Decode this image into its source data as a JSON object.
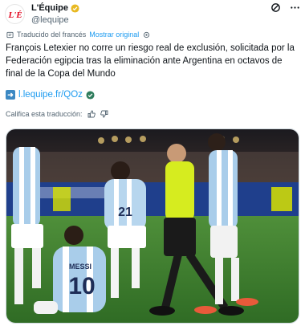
{
  "account": {
    "display_name": "L'Équipe",
    "handle": "@lequipe",
    "logo_text": "L'É",
    "brand_color": "#e2001a",
    "verified_color": "#e8b923"
  },
  "translation": {
    "label": "Traducido del francés",
    "show_original": "Mostrar original"
  },
  "tweet": {
    "text": "François Letexier no corre un riesgo real de exclusión, solicitada por la Federación egipcia tras la eliminación ante Argentina en octavos de final de la Copa del Mundo",
    "link": "l.lequipe.fr/QOz"
  },
  "rating": {
    "label": "Califica esta traducción:"
  },
  "media": {
    "jersey_number": "10",
    "jersey_name": "MESSI",
    "jersey_number_2": "21"
  }
}
